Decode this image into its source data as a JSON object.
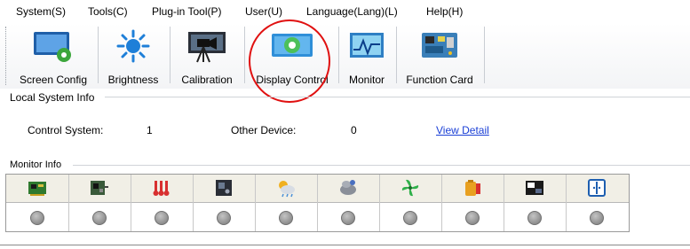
{
  "menu": {
    "items": [
      {
        "label": "System(S)"
      },
      {
        "label": "Tools(C)"
      },
      {
        "label": "Plug-in Tool(P)"
      },
      {
        "label": "User(U)"
      },
      {
        "label": "Language(Lang)(L)"
      },
      {
        "label": "Help(H)"
      }
    ]
  },
  "toolbar": {
    "buttons": [
      {
        "label": "Screen Config",
        "icon": "screen-config-icon"
      },
      {
        "label": "Brightness",
        "icon": "brightness-icon"
      },
      {
        "label": "Calibration",
        "icon": "calibration-icon"
      },
      {
        "label": "Display Control",
        "icon": "display-control-icon"
      },
      {
        "label": "Monitor",
        "icon": "monitor-icon"
      },
      {
        "label": "Function Card",
        "icon": "function-card-icon"
      }
    ],
    "highlight_color": "#e01010"
  },
  "local_system_info": {
    "title": "Local System Info",
    "control_system_label": "Control System:",
    "control_system_value": "1",
    "other_device_label": "Other Device:",
    "other_device_value": "0",
    "view_detail_link": "View Detail"
  },
  "monitor_info": {
    "title": "Monitor Info",
    "columns": [
      {
        "icon": "receiving-card-icon",
        "status": "unknown"
      },
      {
        "icon": "module-board-icon",
        "status": "unknown"
      },
      {
        "icon": "temperature-icon",
        "status": "unknown"
      },
      {
        "icon": "chip-card-icon",
        "status": "unknown"
      },
      {
        "icon": "humidity-weather-icon",
        "status": "unknown"
      },
      {
        "icon": "smoke-sensor-icon",
        "status": "unknown"
      },
      {
        "icon": "fan-icon",
        "status": "unknown"
      },
      {
        "icon": "power-battery-icon",
        "status": "unknown"
      },
      {
        "icon": "cabinet-door-icon",
        "status": "unknown"
      },
      {
        "icon": "power-switch-icon",
        "status": "unknown"
      }
    ],
    "status_color": "#9a9a9a"
  }
}
